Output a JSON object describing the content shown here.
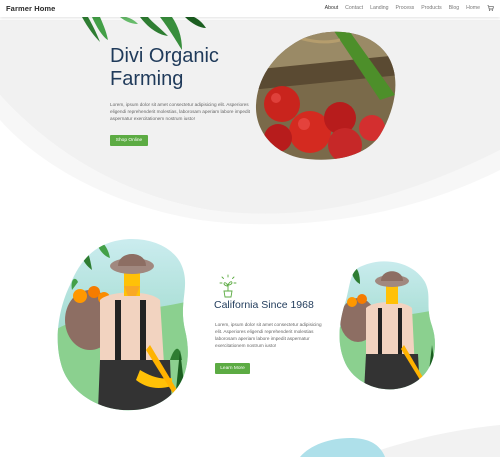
{
  "site": {
    "logo": "Farmer Home",
    "nav": [
      "About",
      "Contact",
      "Landing",
      "Process",
      "Products",
      "Blog",
      "Home"
    ],
    "cart_icon": "cart-icon"
  },
  "hero": {
    "title": "Divi Organic\nFarming",
    "body": "Lorem, ipsum dolor sit amet consectetur adipisicing elit. Asperiores eligendi reprehenderit molestias, laborosam aperiam labore impedit aspernatur exercitationem nostrum iusto!",
    "button": "Shop Online"
  },
  "feature": {
    "title": "California Since 1968",
    "body": "Lorem, ipsum dolor sit amet consectetur adipisicing elit. Asperiores eligendi reprehenderit molestias laborosam aperiam labore impedit aspernatur exercitationem nostrum iusto!",
    "button": "Learn More",
    "icon": "sprout-icon"
  },
  "colors": {
    "accent": "#5cab43",
    "title": "#1f3a5a"
  }
}
